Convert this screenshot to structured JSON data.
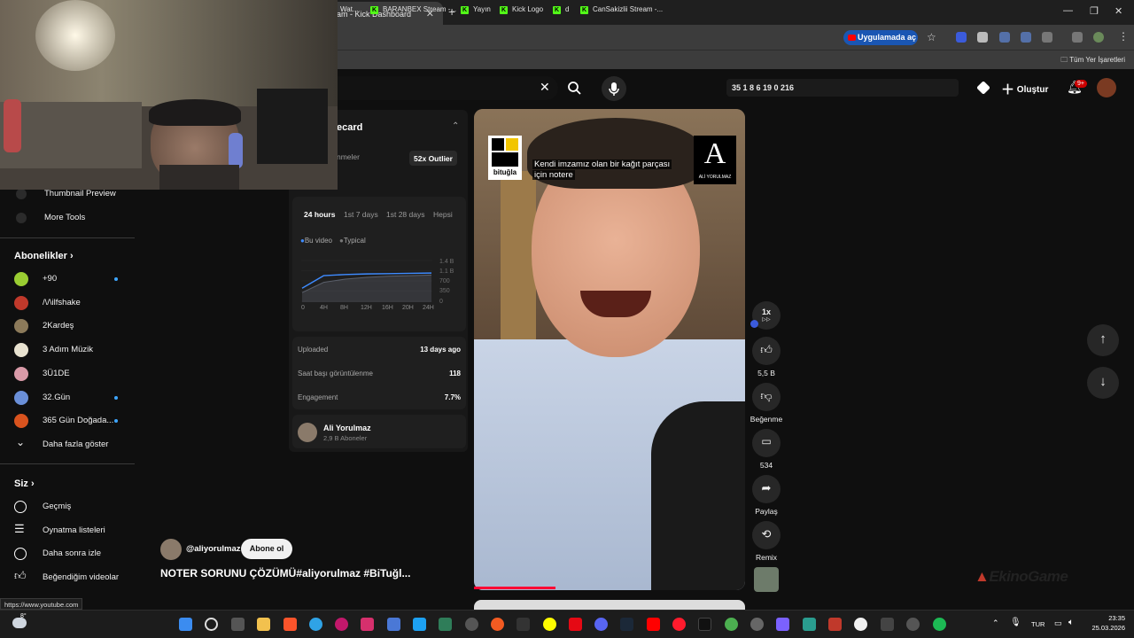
{
  "browser": {
    "tab_title": "am - Kick Dashboard",
    "tab_close": "✕",
    "new_tab": "+",
    "open_in_app": "Uygulamada aç",
    "bookmarks": [
      "Wat...",
      "BARANBEX Stream -...",
      "Yayın",
      "Kick Logo",
      "d",
      "CanSakizlii Stream -..."
    ],
    "all_bookmarks": "Tüm Yer İşaretleri",
    "kick_letter": "K"
  },
  "header": {
    "stats": "35   1   8   6   19   0   216",
    "create_label": "Oluştur",
    "notif_count": "9+"
  },
  "sidebar": {
    "tools": [
      {
        "label": "Thumbnail Preview"
      },
      {
        "label": "More Tools"
      }
    ],
    "subs_heading": "Abonelikler",
    "subs": [
      {
        "label": "+90",
        "color": "#9acd32",
        "dot": true
      },
      {
        "label": "/\\/\\ilfshake",
        "color": "#c0392b",
        "dot": false
      },
      {
        "label": "2Kardeş",
        "color": "#8c7a5a",
        "dot": false
      },
      {
        "label": "3 Adım Müzik",
        "color": "#e8e2d0",
        "dot": false
      },
      {
        "label": "3Ü1DE",
        "color": "#d99aa8",
        "dot": false
      },
      {
        "label": "32.Gün",
        "color": "#6a8fd8",
        "dot": true
      },
      {
        "label": "365 Gün Doğada...",
        "color": "#d9531e",
        "dot": true
      }
    ],
    "show_more": "Daha fazla göster",
    "you_heading": "Siz",
    "you_items": [
      {
        "label": "Geçmiş"
      },
      {
        "label": "Oynatma listeleri"
      },
      {
        "label": "Daha sonra izle"
      },
      {
        "label": "Beğendiğim videolar"
      }
    ]
  },
  "panel": {
    "title": "ecard",
    "subtitle": "nmeler",
    "outlier": "52x Outlier",
    "tabs": [
      "24 hours",
      "1st 7 days",
      "1st 28 days",
      "Hepsi"
    ],
    "legend": [
      "Bu video",
      "Typical"
    ],
    "y_ticks": [
      "1.4 B",
      "1.1 B",
      "700",
      "350",
      "0"
    ],
    "x_ticks": [
      "0",
      "4H",
      "8H",
      "12H",
      "16H",
      "20H",
      "24H"
    ],
    "rows": [
      {
        "label": "Uploaded",
        "value": "13 days ago"
      },
      {
        "label": "Saat başı görüntülenme",
        "value": "118"
      },
      {
        "label": "Engagement",
        "value": "7.7%"
      }
    ],
    "channel_name": "Ali Yorulmaz",
    "channel_subs": "2,9 B Aboneler"
  },
  "chart_data": {
    "type": "line",
    "x": [
      "0",
      "4H",
      "8H",
      "12H",
      "16H",
      "20H",
      "24H"
    ],
    "series": [
      {
        "name": "Bu video",
        "values": [
          0.45,
          0.88,
          0.92,
          0.94,
          0.95,
          0.96,
          0.97
        ]
      },
      {
        "name": "Typical",
        "values": [
          0.3,
          0.65,
          0.76,
          0.82,
          0.86,
          0.88,
          0.9
        ]
      }
    ],
    "ylim": [
      0,
      1.4
    ]
  },
  "video": {
    "overlay_text_1": "Kendi imzamız olan bir kağıt parçası",
    "overlay_text_2": "için notere",
    "logo_left": "bituğla",
    "logo_right": "ALİ YORULMAZ",
    "logo_right_letter": "A",
    "speed": "1x",
    "like_count": "5,5 B",
    "dislike_label": "Beğenme",
    "comment_count": "534",
    "share_label": "Paylaş",
    "remix_label": "Remix",
    "channel_handle": "@aliyorulmaz",
    "subscribe_label": "Abone ol",
    "title": "NOTER SORUNU ÇÖZÜMÜ#aliyorulmaz #BiTuğl..."
  },
  "status_url": "https://www.youtube.com",
  "watermark": "EkinoGame",
  "taskbar": {
    "lang": "TUR",
    "time": "23:35",
    "date": "25.03.2026",
    "weather": "8°"
  }
}
